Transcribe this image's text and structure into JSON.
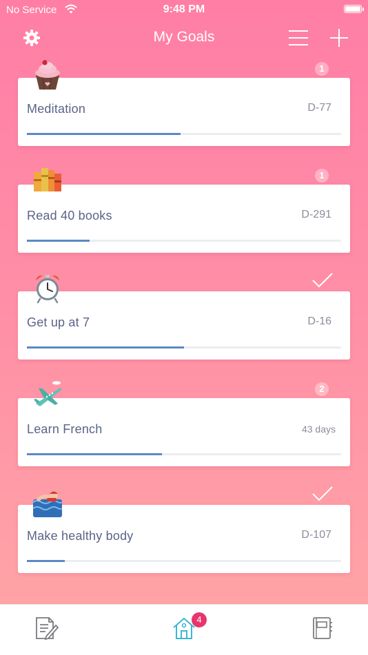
{
  "status_bar": {
    "carrier": "No Service",
    "time": "9:48 PM"
  },
  "nav": {
    "title": "My Goals"
  },
  "goals": [
    {
      "name": "Meditation",
      "dday": "D-77",
      "progress": 0.49,
      "badge": "1",
      "completed": false,
      "icon": "cupcake-icon"
    },
    {
      "name": "Read 40 books",
      "dday": "D-291",
      "progress": 0.2,
      "badge": "1",
      "completed": false,
      "icon": "books-icon"
    },
    {
      "name": "Get up at 7",
      "dday": "D-16",
      "progress": 0.5,
      "badge": "",
      "completed": true,
      "icon": "alarm-clock-icon"
    },
    {
      "name": "Learn French",
      "dday": "43 days",
      "progress": 0.43,
      "badge": "2",
      "completed": false,
      "icon": "airplane-icon"
    },
    {
      "name": "Make healthy body",
      "dday": "D-107",
      "progress": 0.12,
      "badge": "",
      "completed": true,
      "icon": "swimmer-icon"
    }
  ],
  "tabbar": {
    "home_badge": "4"
  },
  "colors": {
    "progress": "#5B88C4",
    "badge": "#E8356D",
    "text": "#5A6487"
  }
}
